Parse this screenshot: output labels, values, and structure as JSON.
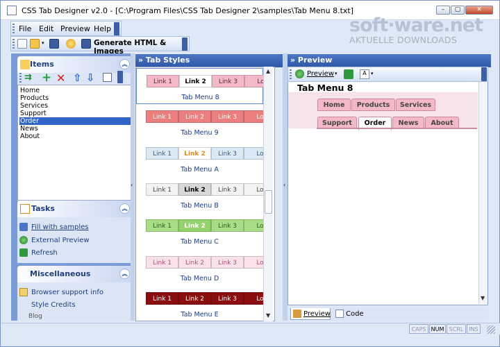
{
  "window": {
    "title": "CSS Tab Designer v2.0 - [C:\\Program Files\\CSS Tab Designer 2\\samples\\Tab Menu 8.txt]",
    "minimize": "–",
    "maximize": "▢",
    "close": "✕"
  },
  "menubar": {
    "file": "File",
    "edit": "Edit",
    "preview": "Preview",
    "help": "Help"
  },
  "toolbar": {
    "generate_label": "Generate HTML & Images"
  },
  "brand": {
    "main": "soft·ware.net",
    "sub": "AKTUELLE DOWNLOADS"
  },
  "items_panel": {
    "title": "Items",
    "items": [
      "Home",
      "Products",
      "Services",
      "Support",
      "Order",
      "News",
      "About"
    ],
    "selected_index": 4
  },
  "tasks_panel": {
    "title": "Tasks",
    "links": [
      "Fill with samples",
      "External Preview",
      "Refresh"
    ]
  },
  "misc_panel": {
    "title": "Miscellaneous",
    "links": [
      "Browser support info",
      "Style Credits"
    ],
    "extra": "Blog"
  },
  "tab_styles": {
    "header": "» Tab Styles",
    "styles": [
      {
        "caption": "Tab Menu 8",
        "tabs": [
          "Link 1",
          "Link 2",
          "Link 3",
          "Lo"
        ],
        "bg": "#f4b9c9",
        "active_bg": "#ffffff",
        "text": "#5a2a3a",
        "active_text": "#000000",
        "active": 1
      },
      {
        "caption": "Tab Menu 9",
        "tabs": [
          "Link 1",
          "Link 2",
          "Link 3",
          "Lo"
        ],
        "bg": "#ec7e7e",
        "active_bg": "#ec7e7e",
        "text": "#ffffff",
        "active_text": "#ffffff",
        "active": -1
      },
      {
        "caption": "Tab Menu A",
        "tabs": [
          "Link 1",
          "Link 2",
          "Link 3",
          "Lo"
        ],
        "bg": "#dbe9f4",
        "active_bg": "#ffffff",
        "text": "#3d5a78",
        "active_text": "#e08a1f",
        "active": 1
      },
      {
        "caption": "Tab Menu B",
        "tabs": [
          "Link 1",
          "Link 2",
          "Link 3",
          "Lo"
        ],
        "bg": "#f3f3f3",
        "active_bg": "#d8d8d8",
        "text": "#444444",
        "active_text": "#000000",
        "active": 1
      },
      {
        "caption": "Tab Menu C",
        "tabs": [
          "Link 1",
          "Link 2",
          "Link 3",
          "Lo"
        ],
        "bg": "#a9dc86",
        "active_bg": "#94d36c",
        "text": "#2e5b1a",
        "active_text": "#ffffff",
        "active": 1
      },
      {
        "caption": "Tab Menu D",
        "tabs": [
          "Link 1",
          "Link 2",
          "Link 3",
          "Lo"
        ],
        "bg": "#fbe1ea",
        "active_bg": "#fbe1ea",
        "text": "#b05070",
        "active_text": "#b05070",
        "active": -1
      },
      {
        "caption": "Tab Menu E",
        "tabs": [
          "Link 1",
          "Link 2",
          "Link 3",
          "Lo"
        ],
        "bg": "#8a0e0e",
        "active_bg": "#b01010",
        "text": "#ffffff",
        "active_text": "#ffffff",
        "active": -1
      }
    ]
  },
  "preview": {
    "header": "» Preview",
    "tb_preview": "Preview",
    "title": "Tab Menu 8",
    "row1": [
      "Home",
      "Products",
      "Services"
    ],
    "row2": [
      "Support",
      "Order",
      "News",
      "About"
    ],
    "active": "Order",
    "tab_color": "#f4b9c9",
    "tab_active_color": "#ffffff",
    "bottom_tabs": [
      "Preview",
      "Code"
    ]
  },
  "status": {
    "caps": "CAPS",
    "num": "NUM",
    "scrl": "SCRL",
    "ins": "INS"
  }
}
